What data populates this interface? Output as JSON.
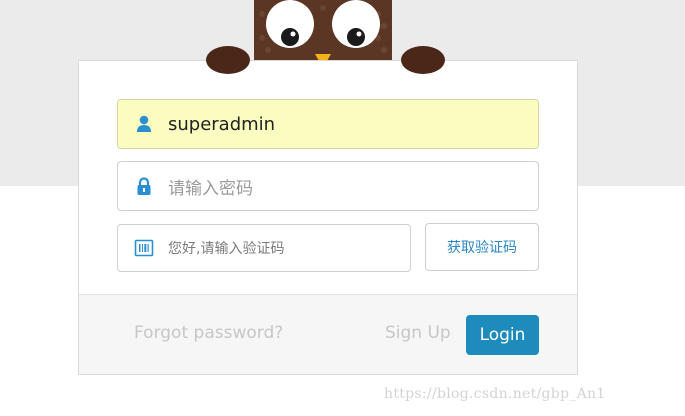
{
  "login_form": {
    "username": {
      "value": "superadmin",
      "icon": "user-icon"
    },
    "password": {
      "placeholder": "请输入密码",
      "icon": "lock-icon"
    },
    "captcha": {
      "placeholder": "您好,请输入验证码",
      "icon": "barcode-icon",
      "button_label": "获取验证码"
    }
  },
  "footer": {
    "forgot_label": "Forgot password?",
    "signup_label": "Sign Up",
    "login_label": "Login"
  },
  "watermark": "https://blog.csdn.net/gbp_An1",
  "colors": {
    "accent": "#1d8bbb",
    "icon": "#2a8fd0",
    "autofill_bg": "#fafdbf",
    "owl_brown": "#5b3624",
    "top_band": "#ebebeb"
  }
}
